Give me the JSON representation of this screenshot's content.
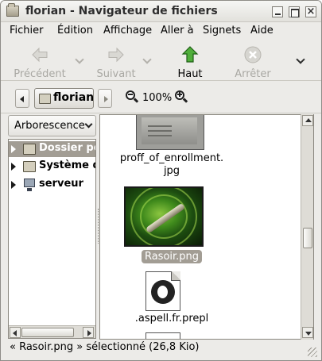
{
  "window": {
    "title": "florian - Navigateur de fichiers"
  },
  "menubar": {
    "items": [
      "Fichier",
      "Édition",
      "Affichage",
      "Aller à",
      "Signets",
      "Aide"
    ]
  },
  "toolbar": {
    "back_label": "Précédent",
    "forward_label": "Suivant",
    "home_label": "Haut",
    "stop_label": "Arrêter",
    "back_icon": "left-arrow-icon",
    "forward_icon": "right-arrow-icon",
    "home_icon": "up-arrow-icon",
    "stop_icon": "stop-icon"
  },
  "location": {
    "path_button_label": "florian",
    "zoom_level": "100%"
  },
  "sidepane": {
    "view_selector": "Arborescence",
    "tree": [
      {
        "label": "Dossier personnel",
        "selected": true
      },
      {
        "label": "Système de fichiers",
        "selected": false
      },
      {
        "label": "serveur",
        "selected": false
      }
    ]
  },
  "files": [
    {
      "name_line1": "proff_of_enrollment.",
      "name_line2": "jpg"
    },
    {
      "name": "Rasoir.png",
      "selected": true
    },
    {
      "name": ".aspell.fr.prepl"
    }
  ],
  "status": {
    "text": "« Rasoir.png » sélectionné (26,8 Kio)"
  },
  "colors": {
    "selection": "#a29d94",
    "home_arrow": "#3e9a2e",
    "window_bg": "#ecebe8"
  }
}
